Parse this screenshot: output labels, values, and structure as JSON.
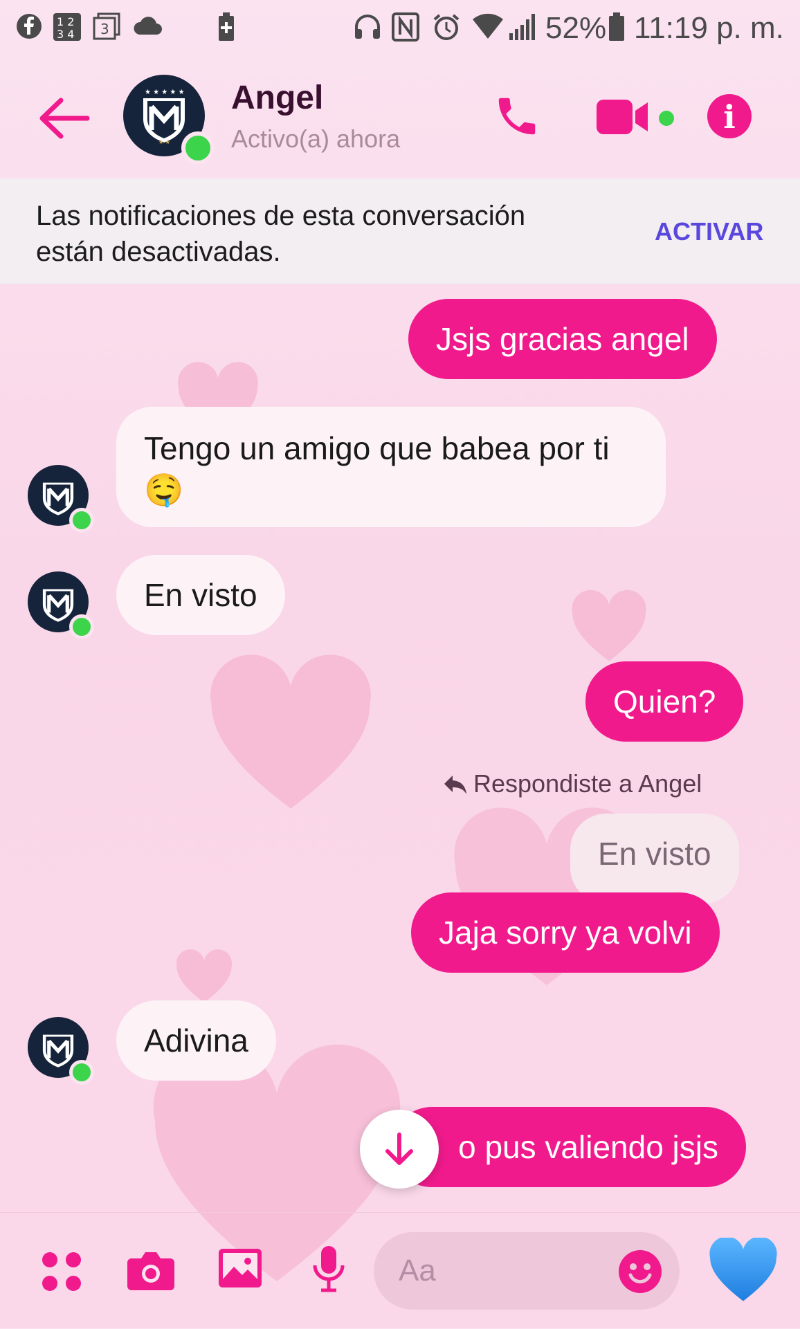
{
  "status_bar": {
    "battery_percent": "52%",
    "time": "11:19 p. m.",
    "icons": [
      "facebook-icon",
      "number-pad-icon",
      "news-app-icon",
      "cloud-icon",
      "battery-saver-icon",
      "headphones-icon",
      "nfc-icon",
      "alarm-icon",
      "wifi-icon",
      "signal-icon",
      "battery-icon"
    ]
  },
  "header": {
    "contact_name": "Angel",
    "contact_status": "Activo(a) ahora",
    "accent_color": "#f01a8c",
    "online_color": "#3bd44a"
  },
  "notification_banner": {
    "message": "Las notificaciones de esta conversación están desactivadas.",
    "action_label": "ACTIVAR"
  },
  "messages": [
    {
      "direction": "out",
      "text": "Jsjs gracias angel"
    },
    {
      "direction": "in",
      "text": "Tengo un amigo que babea por ti 🤤"
    },
    {
      "direction": "in",
      "text": "En visto"
    },
    {
      "direction": "out",
      "text": "Quien?"
    },
    {
      "direction": "out",
      "reply_label": "Respondiste a Angel",
      "quoted_text": "En visto",
      "text": "Jaja sorry ya volvi"
    },
    {
      "direction": "in",
      "text": "Adivina"
    },
    {
      "direction": "out",
      "text": "o pus valiendo jsjs"
    }
  ],
  "composer": {
    "placeholder": "Aa",
    "like_color": "#2f8ff0"
  }
}
